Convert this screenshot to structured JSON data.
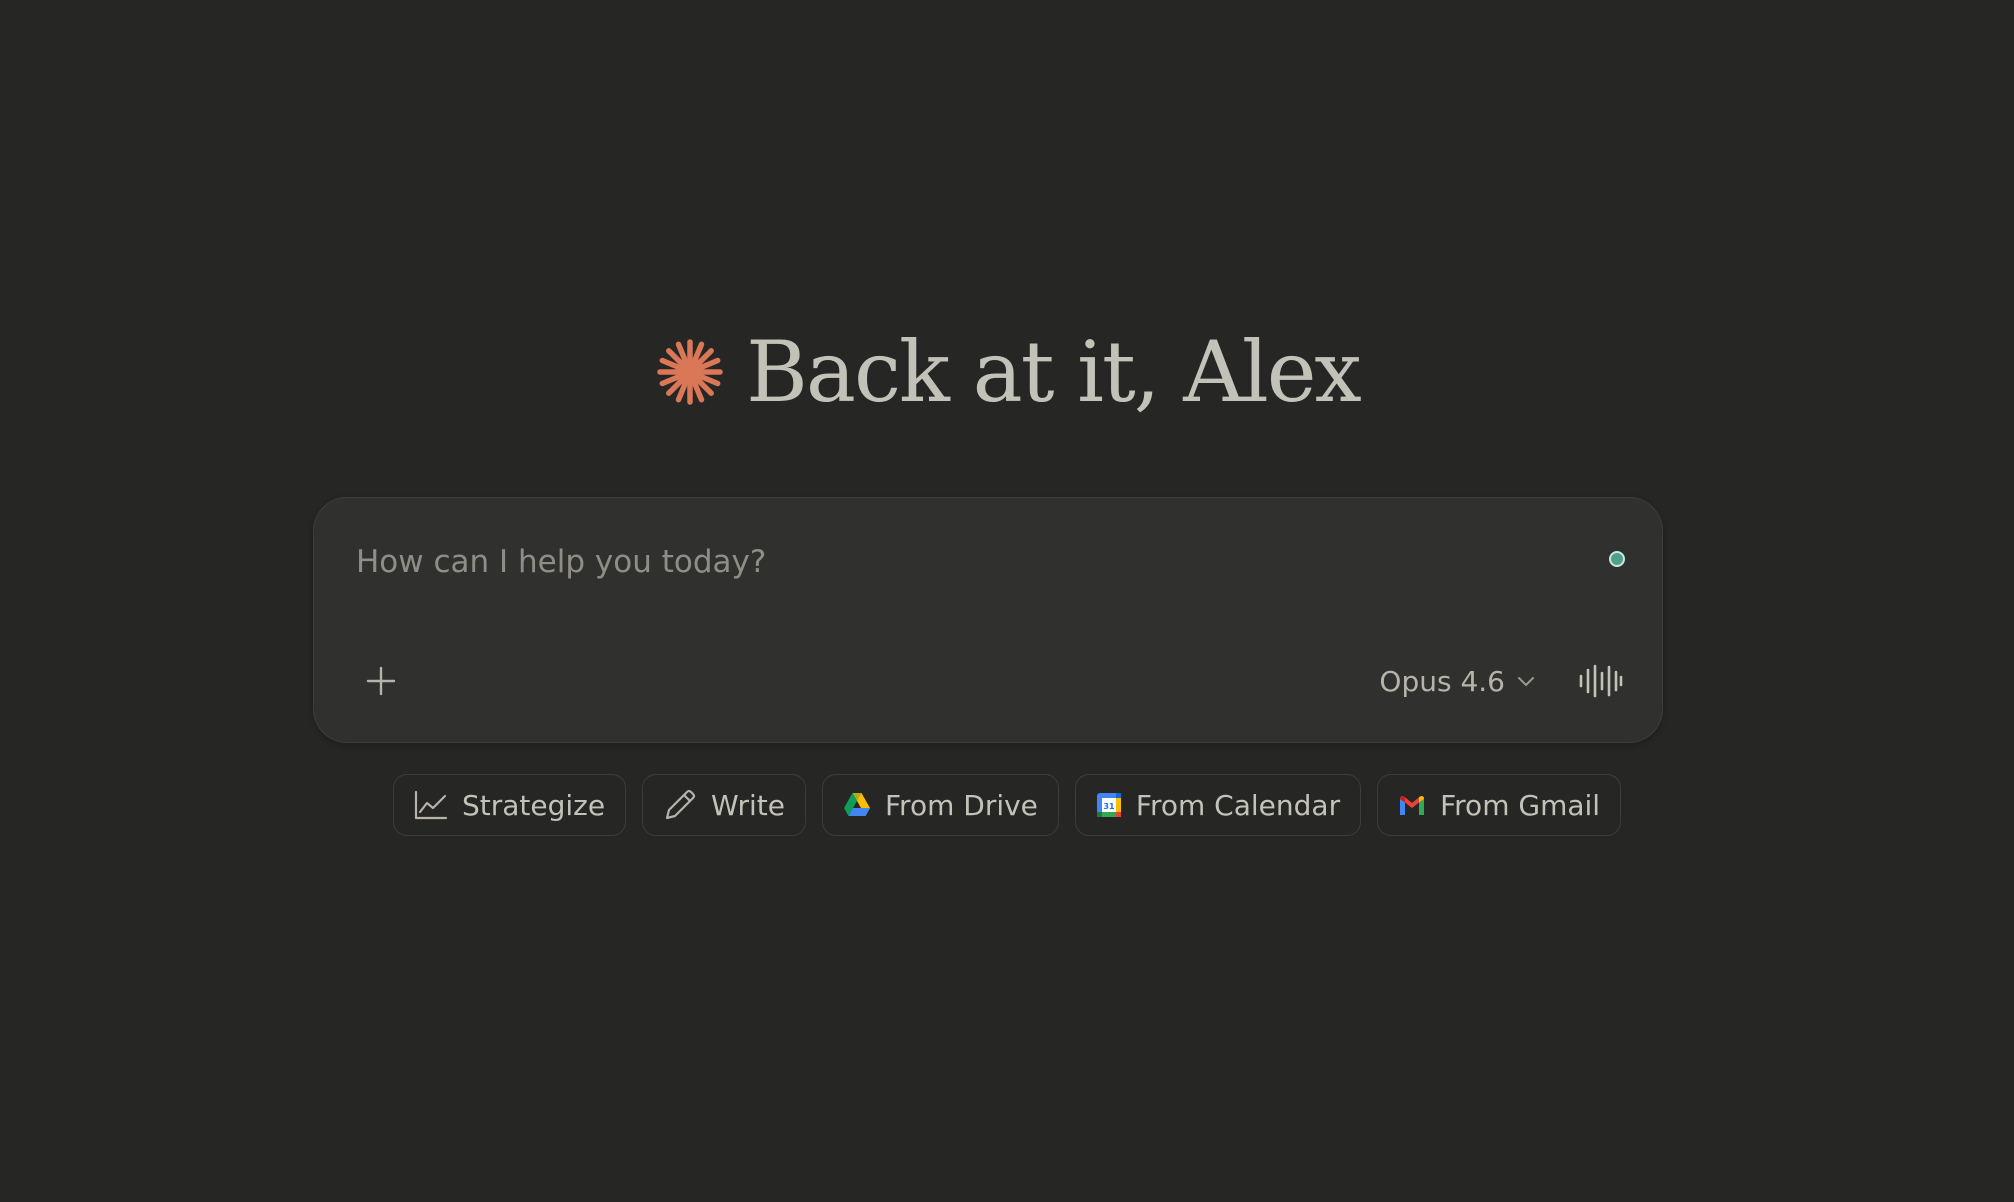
{
  "greeting": {
    "logo_icon": "sparkle-icon",
    "title": "Back at it, Alex"
  },
  "composer": {
    "placeholder": "How can I help you today?",
    "value": "",
    "add_icon": "plus-icon",
    "model": "Opus 4.6",
    "model_icon": "chevron-down-icon",
    "voice_icon": "waveform-icon",
    "status_color": "#4ea08a"
  },
  "chips": [
    {
      "label": "Strategize",
      "icon": "chart-line-icon"
    },
    {
      "label": "Write",
      "icon": "pencil-icon"
    },
    {
      "label": "From Drive",
      "icon": "google-drive-icon"
    },
    {
      "label": "From Calendar",
      "icon": "google-calendar-icon"
    },
    {
      "label": "From Gmail",
      "icon": "gmail-icon"
    }
  ],
  "colors": {
    "background": "#262624",
    "accent": "#d97757",
    "text": "#c3c2b8",
    "composer_bg": "#30302e"
  }
}
